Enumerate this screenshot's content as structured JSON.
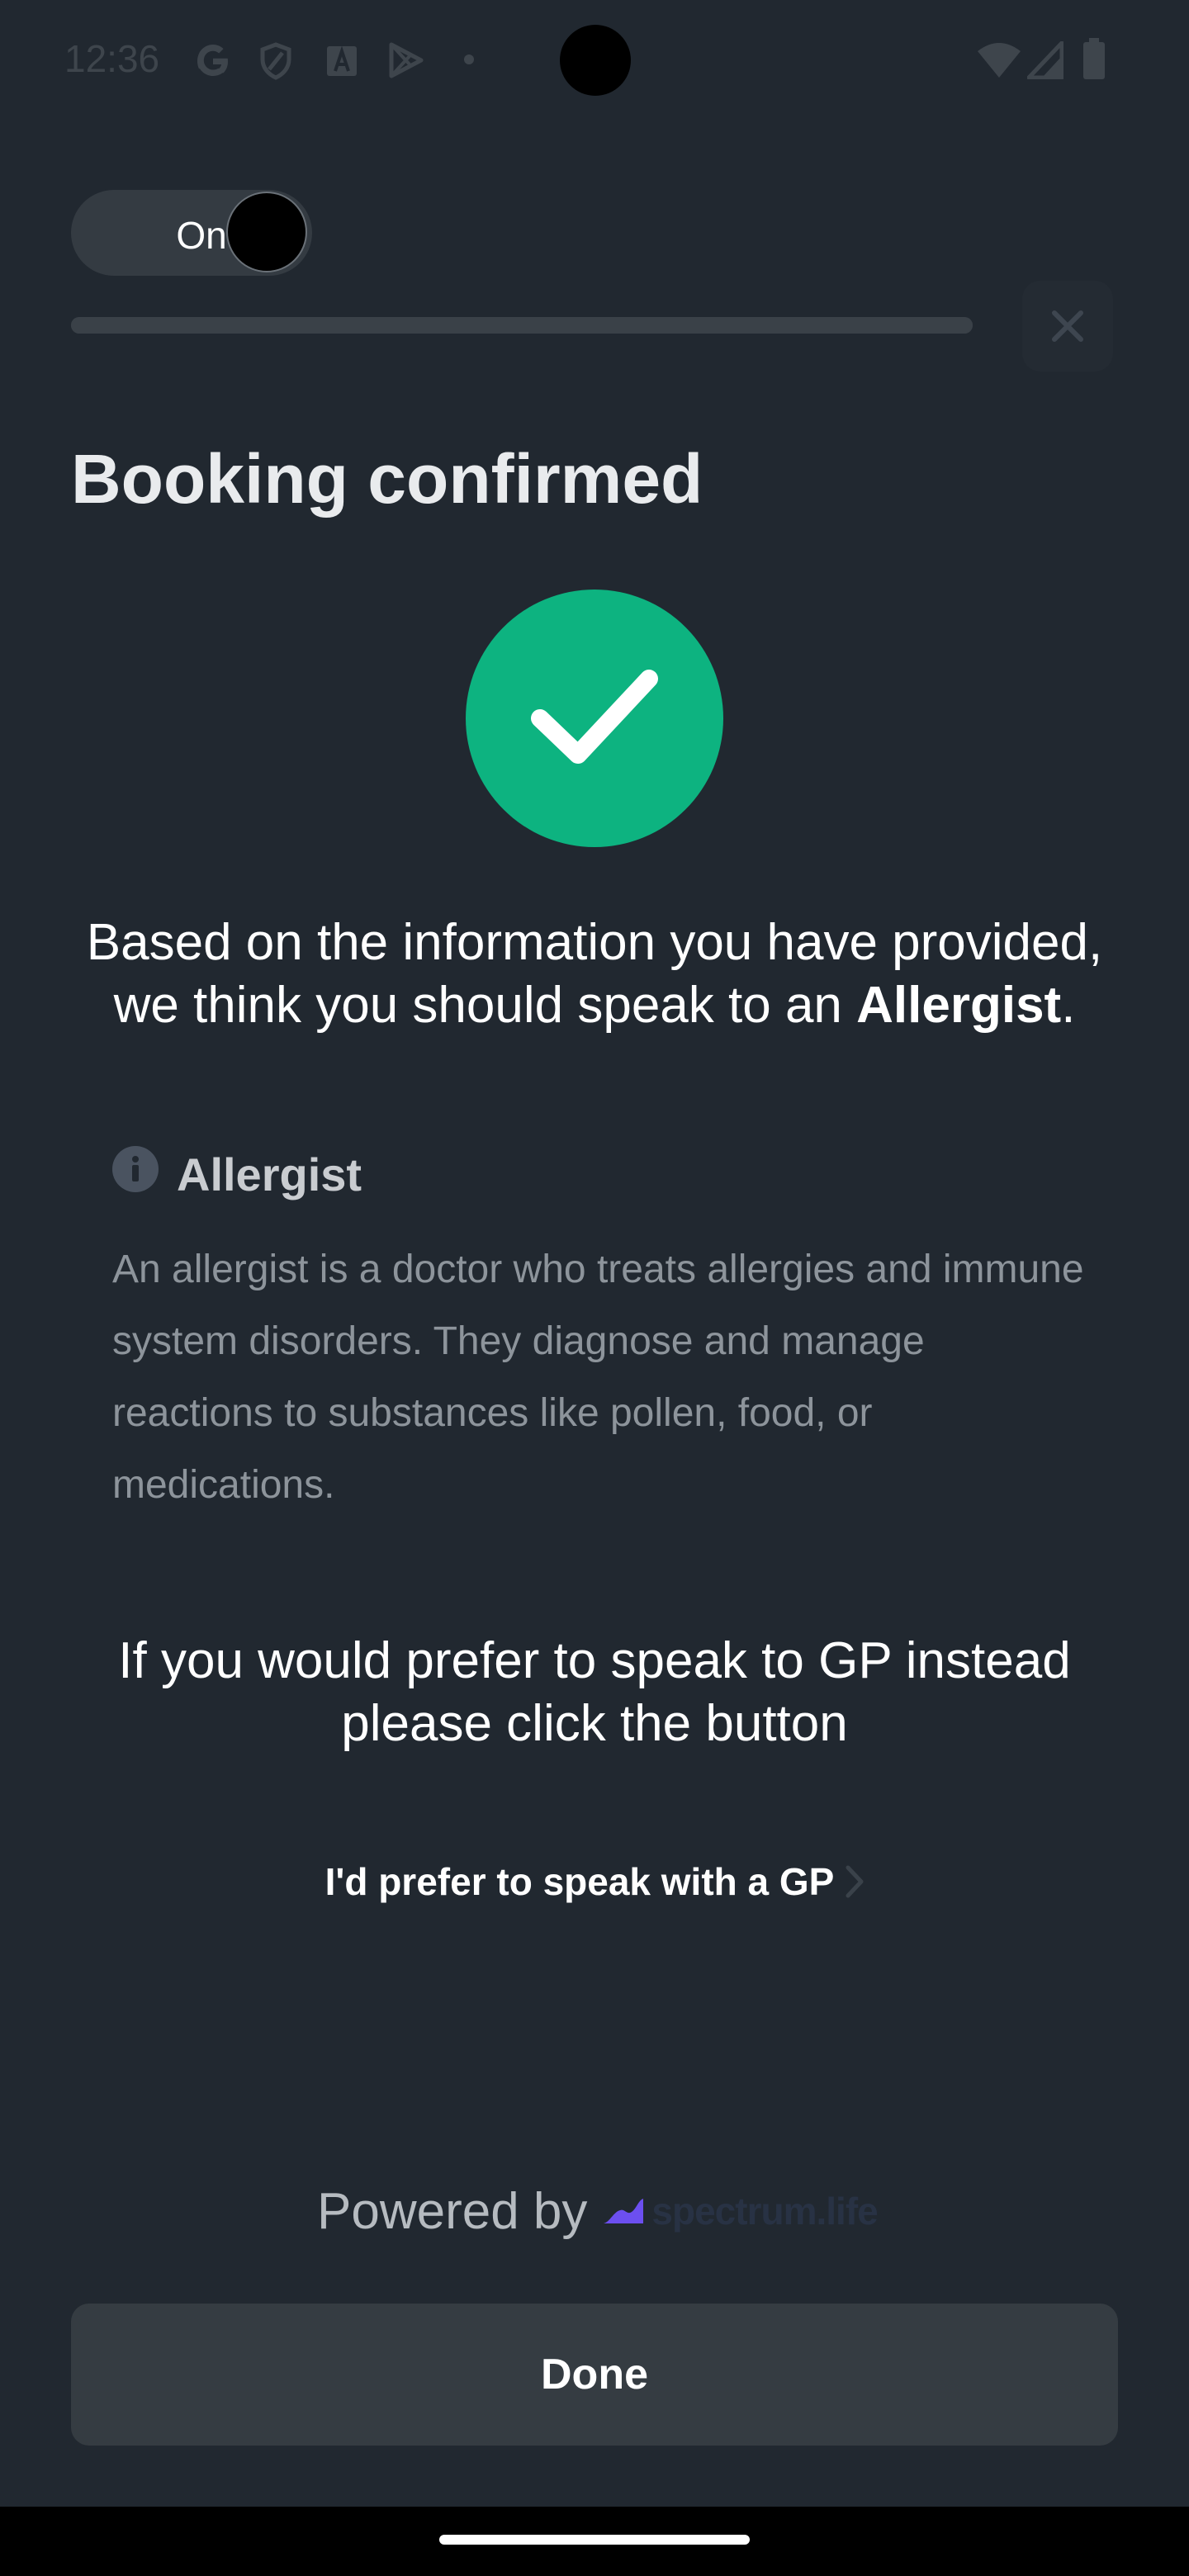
{
  "status_bar": {
    "time": "12:36",
    "left_icons": [
      "google-icon",
      "shield-icon",
      "font-icon",
      "play-store-icon",
      "dot-icon"
    ],
    "right_icons": [
      "wifi-icon",
      "cell-signal-icon",
      "battery-icon"
    ]
  },
  "toggle": {
    "label": "On",
    "state": "on"
  },
  "header": {
    "close_icon": "close-icon"
  },
  "main": {
    "title": "Booking confirmed",
    "reco_part1": "Based on the information you have provided, we think you should speak to an ",
    "reco_bold": "Allergist",
    "reco_end": ".",
    "info": {
      "icon": "info-icon",
      "title": "Allergist",
      "description": "An allergist is a doctor who treats allergies and immune system disorders. They diagnose and manage reactions to substances like pollen, food, or medications."
    },
    "prefer_text": "If you would prefer to speak to GP instead please click the button",
    "gp_link_label": "I'd prefer to speak with a GP"
  },
  "footer": {
    "powered_by": "Powered by",
    "brand_name": "spectrum.life",
    "done_label": "Done"
  },
  "colors": {
    "background": "#212830",
    "success": "#0db380",
    "brand": "#6c4ff0",
    "button": "#353c42"
  }
}
